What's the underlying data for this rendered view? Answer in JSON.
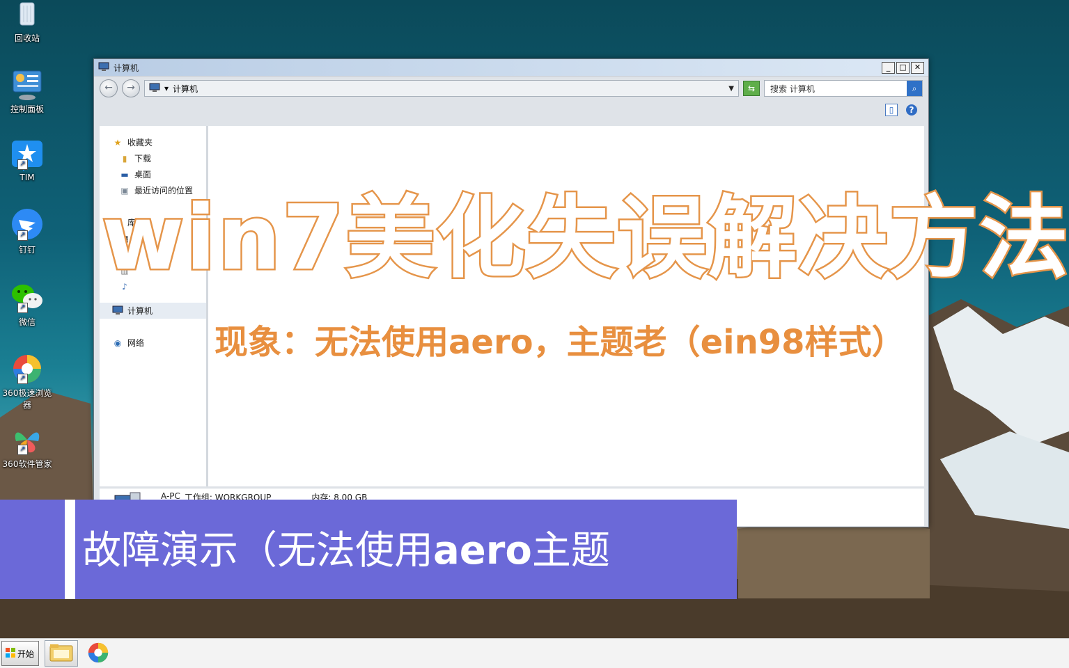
{
  "desktop": {
    "icons": [
      {
        "label": "回收站",
        "icon": "recycle-bin-icon"
      },
      {
        "label": "控制面板",
        "icon": "control-panel-icon"
      },
      {
        "label": "TIM",
        "icon": "tim-icon"
      },
      {
        "label": "钉钉",
        "icon": "dingtalk-icon"
      },
      {
        "label": "微信",
        "icon": "wechat-icon"
      },
      {
        "label": "360极速浏览器",
        "icon": "360-browser-icon"
      },
      {
        "label": "360软件管家",
        "icon": "360-software-manager-icon"
      }
    ]
  },
  "window": {
    "title": "计算机",
    "address": "计算机",
    "search_placeholder": "搜索 计算机",
    "nav": {
      "favorites": "收藏夹",
      "downloads": "下载",
      "desktop": "桌面",
      "recent": "最近访问的位置",
      "libraries": "库",
      "computer": "计算机",
      "network": "网络"
    },
    "details": {
      "pc_name": "A-PC",
      "workgroup": "工作组: WORKGROUP",
      "memory": "内存: 8.00 GB"
    }
  },
  "overlay": {
    "title": "win7美化失误解决方法",
    "subtitle": "现象：无法使用aero，主题老（ein98样式）"
  },
  "banner": {
    "text_before": "故障演示（无法使用",
    "text_bold": "aero",
    "text_after": "主题"
  },
  "taskbar": {
    "start_label": "开始"
  },
  "colors": {
    "overlay_orange": "#e5954a",
    "banner_purple": "#6b69d8"
  }
}
